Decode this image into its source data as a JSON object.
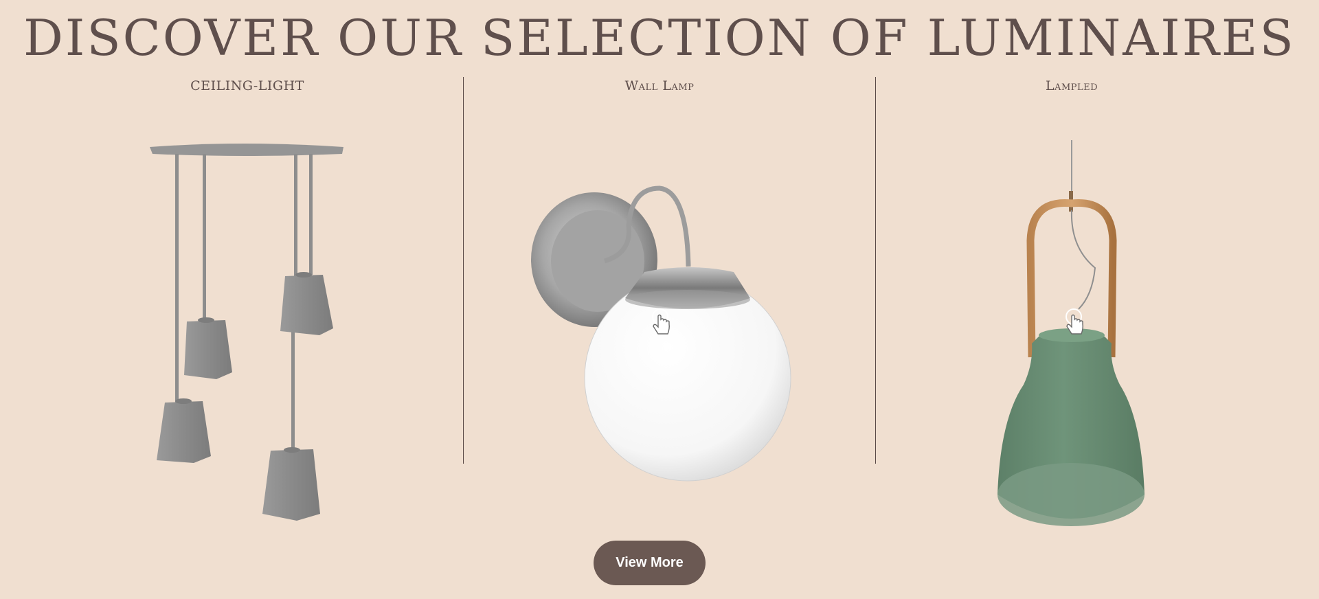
{
  "headline": "DISCOVER OUR SELECTION OF LUMINAIRES",
  "columns": [
    {
      "title": "CEILING-LIGHT",
      "icon": "ceiling-light-icon"
    },
    {
      "title": "Wall Lamp",
      "icon": "wall-lamp-icon"
    },
    {
      "title": "Lampled",
      "icon": "lampled-icon"
    }
  ],
  "cta": {
    "label": "View More"
  },
  "colors": {
    "background": "#f0dfd0",
    "text": "#5f4f4c",
    "button": "#6b5953",
    "button_text": "#ffffff",
    "ceiling_metal": "#8e8e8e",
    "lamp_green": "#6a8f74",
    "wood": "#c9955f"
  }
}
